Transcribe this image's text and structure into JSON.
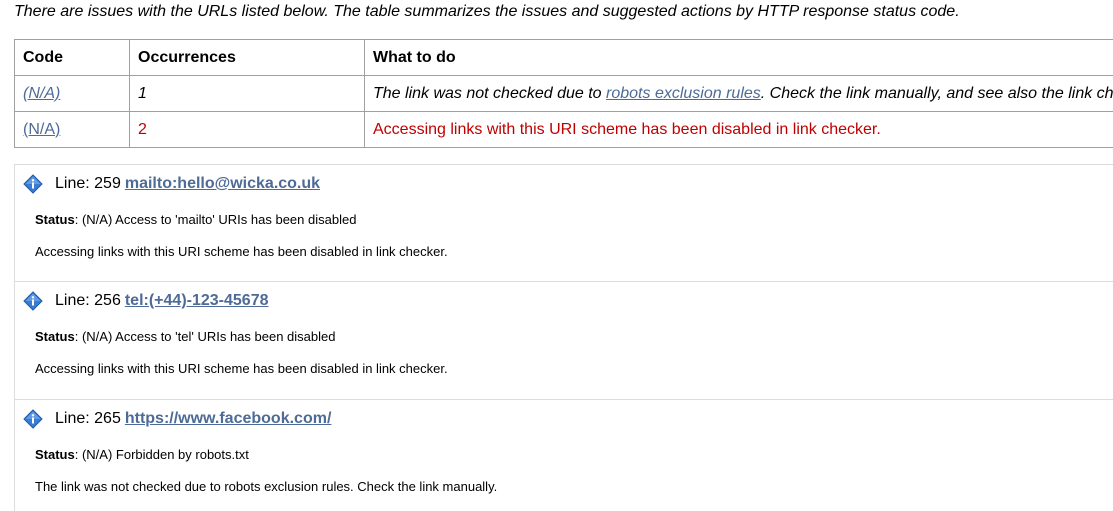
{
  "intro": "There are issues with the URLs listed below. The table summarizes the issues and suggested actions by HTTP response status code.",
  "table": {
    "headers": [
      "Code",
      "Occurrences",
      "What to do"
    ],
    "rows": [
      {
        "code": "(N/A)",
        "occurrences": "1",
        "what_prefix": "The link was not checked due to ",
        "what_link": "robots exclusion rules",
        "what_suffix": ". Check the link manually, and see also the link ch"
      },
      {
        "code": "(N/A)",
        "occurrences": "2",
        "what_text": "Accessing links with this URI scheme has been disabled in link checker."
      }
    ]
  },
  "entries": [
    {
      "line_label": "Line: 259",
      "url": "mailto:hello@wicka.co.uk",
      "status_label": "Status",
      "status_text": ": (N/A) Access to 'mailto' URIs has been disabled",
      "description": "Accessing links with this URI scheme has been disabled in link checker."
    },
    {
      "line_label": "Line: 256",
      "url": "tel:(+44)-123-45678",
      "status_label": "Status",
      "status_text": ": (N/A) Access to 'tel' URIs has been disabled",
      "description": "Accessing links with this URI scheme has been disabled in link checker."
    },
    {
      "line_label": "Line: 265",
      "url": "https://www.facebook.com/",
      "status_label": "Status",
      "status_text": ": (N/A) Forbidden by robots.txt",
      "description": "The link was not checked due to robots exclusion rules. Check the link manually."
    }
  ],
  "colors": {
    "link": "#4d6b96",
    "error_red": "#c00000",
    "info_icon": "#3a7bd5"
  },
  "icons": {
    "entry_icon": "info-icon"
  }
}
